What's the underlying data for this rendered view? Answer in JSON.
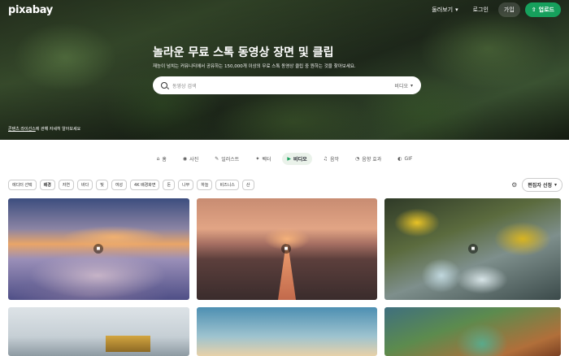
{
  "header": {
    "logo": "pixabay",
    "explore_label": "둘러보기",
    "login_label": "로그인",
    "join_label": "가입",
    "upload_label": "업로드"
  },
  "hero": {
    "title": "놀라운 무료 스톡 동영상 장면 및 클립",
    "subtitle": "재능이 넘치는 커뮤니티에서 공유하는 150,000개 이상의 무료 스톡 동영상 클립 중 원하는 것을 찾아보세요.",
    "search_placeholder": "동영상 검색",
    "search_type": "비디오",
    "license_link": "콘텐츠 라이선스",
    "license_text": "에 관해 자세히 알아보세요"
  },
  "categories": [
    {
      "label": "홈",
      "icon": "home-icon",
      "glyph": "⌂"
    },
    {
      "label": "사진",
      "icon": "camera-icon",
      "glyph": "◉"
    },
    {
      "label": "일러스트",
      "icon": "brush-icon",
      "glyph": "✎"
    },
    {
      "label": "벡터",
      "icon": "vector-icon",
      "glyph": "✦"
    },
    {
      "label": "비디오",
      "icon": "video-icon",
      "glyph": "▶"
    },
    {
      "label": "음악",
      "icon": "music-icon",
      "glyph": "♫"
    },
    {
      "label": "음향 효과",
      "icon": "sound-icon",
      "glyph": "◔"
    },
    {
      "label": "GIF",
      "icon": "gif-icon",
      "glyph": "◐"
    }
  ],
  "filters": {
    "chips": [
      "에디터 선택",
      "배경",
      "자연",
      "바다",
      "빛",
      "여성",
      "4K 배경화면",
      "돈",
      "나무",
      "하늘",
      "비즈니스",
      "산"
    ],
    "sort_label": "편집자 선정"
  },
  "accent_color": "#16a05c"
}
